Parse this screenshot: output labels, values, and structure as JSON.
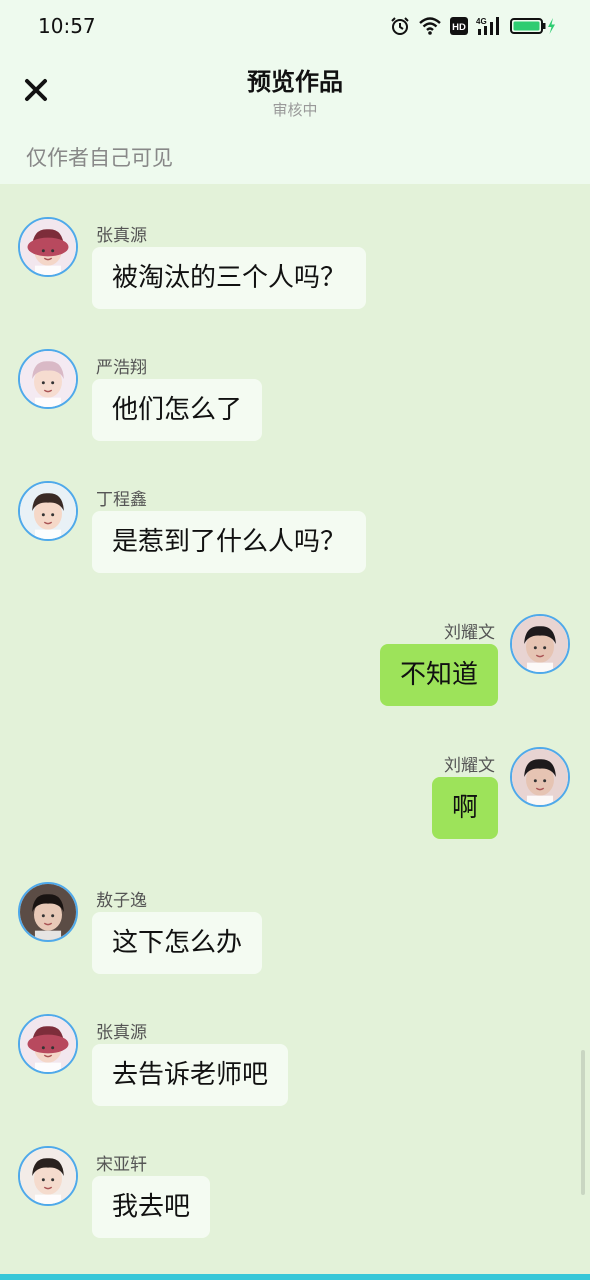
{
  "status_bar": {
    "time": "10:57",
    "icons": [
      "alarm-icon",
      "wifi-icon",
      "hd-icon",
      "4g-signal-icon",
      "battery-charging-icon"
    ],
    "hd_label": "HD",
    "network_label": "4G",
    "battery_color": "#2ecc71"
  },
  "header": {
    "title": "预览作品",
    "subtitle": "审核中",
    "visibility_note": "仅作者自己可见",
    "close_icon": "close-icon"
  },
  "messages": [
    {
      "side": "left",
      "name": "张真源",
      "text": "被淘汰的三个人吗？",
      "avatar": "avatar-zhang-zhenyuan"
    },
    {
      "side": "left",
      "name": "严浩翔",
      "text": "他们怎么了",
      "avatar": "avatar-yan-haoxiang"
    },
    {
      "side": "left",
      "name": "丁程鑫",
      "text": "是惹到了什么人吗？",
      "avatar": "avatar-ding-chengxin"
    },
    {
      "side": "right",
      "name": "刘耀文",
      "text": "不知道",
      "avatar": "avatar-liu-yaowen"
    },
    {
      "side": "right",
      "name": "刘耀文",
      "text": "啊",
      "avatar": "avatar-liu-yaowen"
    },
    {
      "side": "left",
      "name": "敖子逸",
      "text": "这下怎么办",
      "avatar": "avatar-ao-ziyi"
    },
    {
      "side": "left",
      "name": "张真源",
      "text": "去告诉老师吧",
      "avatar": "avatar-zhang-zhenyuan"
    },
    {
      "side": "left",
      "name": "宋亚轩",
      "text": "我去吧",
      "avatar": "avatar-song-yaxuan"
    }
  ],
  "colors": {
    "page_background": "#e3f2d9",
    "header_background": "#eefaee",
    "left_bubble": "#f4fbf2",
    "right_bubble": "#9de35a",
    "avatar_border": "#4fa9ea"
  }
}
